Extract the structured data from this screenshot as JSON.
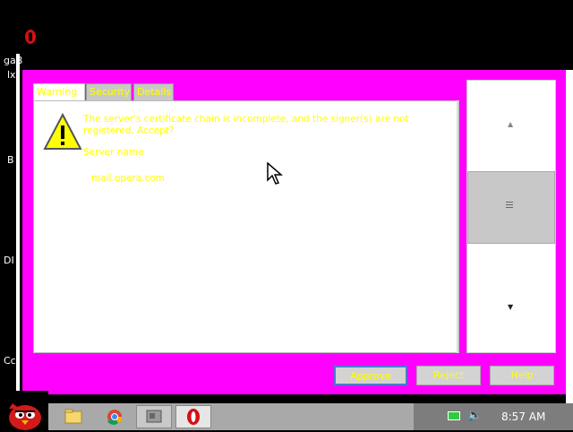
{
  "background": {
    "left_fragments": [
      "gaB",
      "lx",
      "B",
      "DI",
      "Cc"
    ]
  },
  "dialog": {
    "tabs": [
      {
        "label": "Warning"
      },
      {
        "label": "Security"
      },
      {
        "label": "Details"
      }
    ],
    "message": "The server's certificate chain is incomplete, and the signer(s) are not registered. Accept?",
    "server_label": "Server name",
    "server_value": "mail.opera.com",
    "buttons": {
      "approve": "Approve",
      "reject": "Reject",
      "help": "Help"
    },
    "colors": {
      "background": "#ff00ff",
      "text": "#ffff00"
    }
  },
  "taskbar": {
    "clock": "8:57 AM",
    "items": [
      {
        "icon": "folder-icon"
      },
      {
        "icon": "chrome-icon"
      },
      {
        "icon": "app-window-icon"
      },
      {
        "icon": "opera-icon"
      }
    ]
  }
}
